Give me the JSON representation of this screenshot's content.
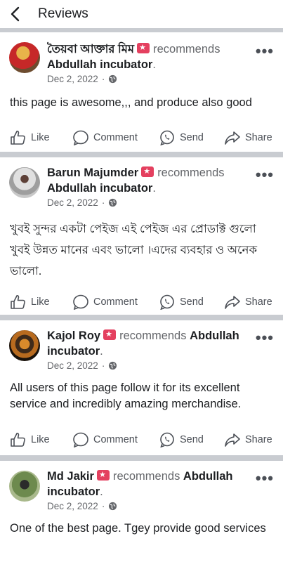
{
  "header": {
    "title": "Reviews"
  },
  "actions": {
    "like": "Like",
    "comment": "Comment",
    "send": "Send",
    "share": "Share"
  },
  "reviews": [
    {
      "name": "তৈয়বা আক্তার মিম",
      "verb": "recommends",
      "page": "Abdullah incubator",
      "date": "Dec 2, 2022",
      "text": "this page is awesome,,, and produce also good"
    },
    {
      "name": "Barun Majumder",
      "verb": "recommends",
      "page": "Abdullah incubator",
      "date": "Dec 2, 2022",
      "text": "খুবই সুন্দর একটা পেইজ এই পেইজ এর প্রোডাক্ট গুলো খুবই উন্নত মানের এবং ভালো ।এদের ব্যবহার ও অনেক ভালো."
    },
    {
      "name": "Kajol Roy",
      "verb": "recommends",
      "page": "Abdullah incubator",
      "date": "Dec 2, 2022",
      "text": "All users of this page follow it for its excellent service and incredibly amazing merchandise."
    },
    {
      "name": "Md Jakir",
      "verb": "recommends",
      "page": "Abdullah incubator",
      "date": "Dec 2, 2022",
      "text": "One of the best page. Tgey provide good services"
    }
  ]
}
